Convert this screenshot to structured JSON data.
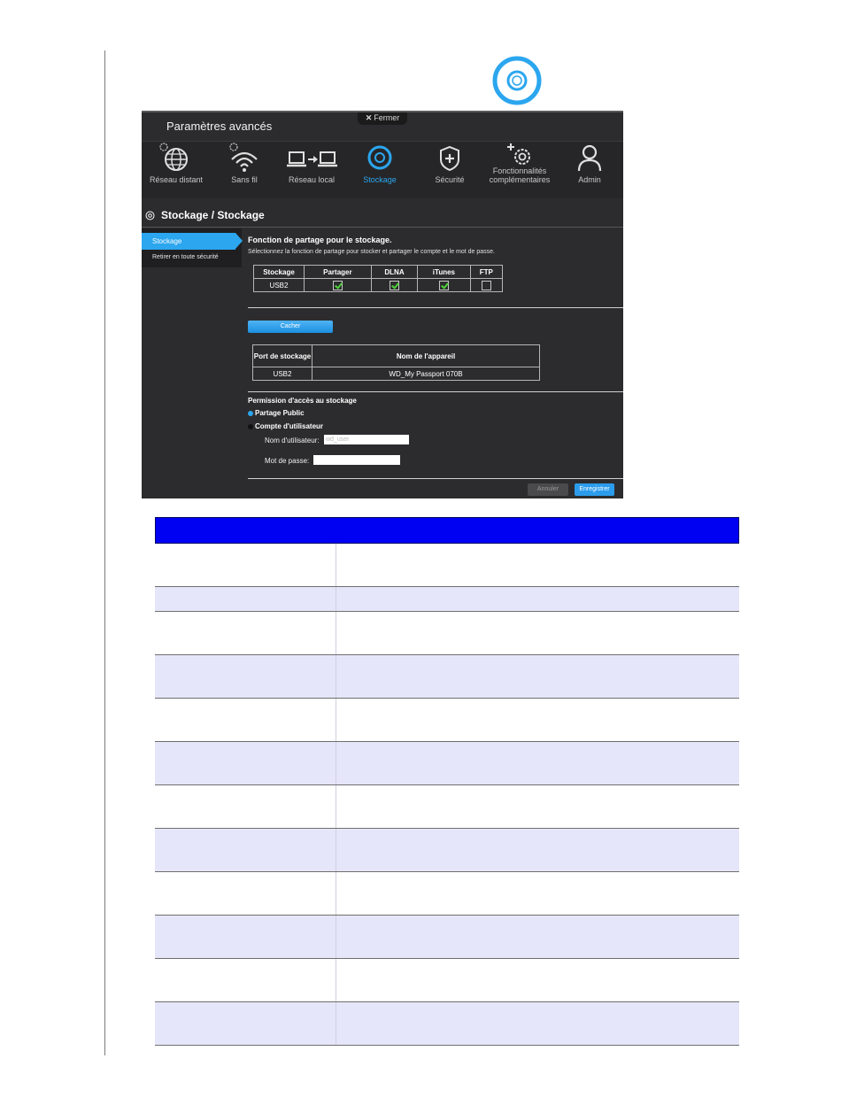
{
  "header_icon": "storage-disc-icon",
  "app": {
    "close_label": "Fermer",
    "title": "Paramètres avancés"
  },
  "nav": [
    {
      "label": "Réseau distant",
      "icon": "globe-gear-icon"
    },
    {
      "label": "Sans fil",
      "icon": "wifi-gear-icon"
    },
    {
      "label": "Réseau local",
      "icon": "laptop-to-laptop-icon"
    },
    {
      "label": "Stockage",
      "icon": "storage-disc-icon",
      "active": true
    },
    {
      "label": "Sécurité",
      "icon": "shield-plus-icon"
    },
    {
      "label": "Fonctionnalités complémentaires",
      "icon": "gears-plus-icon"
    },
    {
      "label": "Admin",
      "icon": "user-icon"
    }
  ],
  "page": {
    "title": "Stockage / Stockage"
  },
  "sidebar": {
    "items": [
      {
        "label": "Stockage",
        "active": true
      },
      {
        "label": "Retirer en toute  sécurité"
      }
    ]
  },
  "sharing": {
    "heading": "Fonction de partage pour le stockage.",
    "subtext": "Sélectionnez la fonction de partage pour stocker et partager le compte et le mot de passe.",
    "columns": [
      "Stockage",
      "Partager",
      "DLNA",
      "iTunes",
      "FTP"
    ],
    "row": {
      "storage": "USB2",
      "partager": true,
      "dlna": true,
      "itunes": true,
      "ftp": false
    }
  },
  "devices": {
    "hide_button": "Cacher",
    "columns": [
      "Port de stockage",
      "Nom de l'appareil"
    ],
    "rows": [
      {
        "port": "USB2",
        "name": "WD_My Passport 070B"
      }
    ]
  },
  "permission": {
    "heading": "Permission d'accès au stockage",
    "public_label": "Partage Public",
    "account_label": "Compte d'utilisateur",
    "username_label": "Nom d'utilisateur:",
    "username_value": "wd_user",
    "password_label": "Mot de passe:",
    "password_value": ""
  },
  "footer": {
    "cancel": "Annuler",
    "save": "Enregistrer"
  },
  "colors": {
    "accent": "#2ba6ef",
    "doc_header": "#0000f2",
    "row_alt": "#e6e6fa"
  }
}
